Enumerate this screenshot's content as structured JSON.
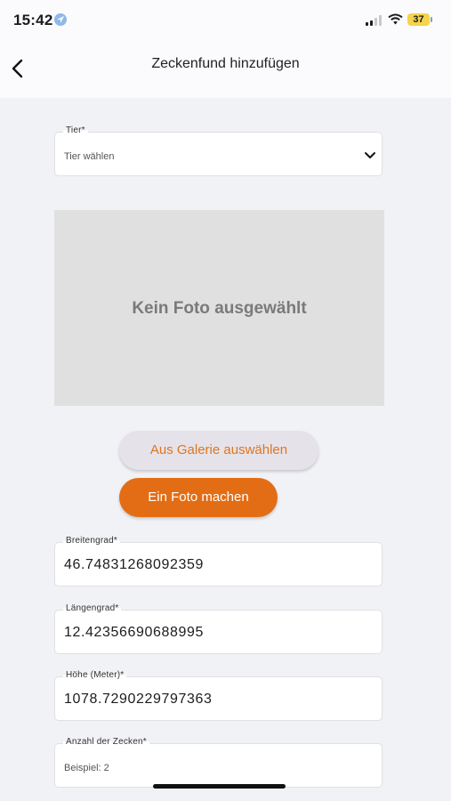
{
  "status_bar": {
    "time": "15:42",
    "battery": "37"
  },
  "nav": {
    "title": "Zeckenfund hinzufügen"
  },
  "animal_field": {
    "label": "Tier*",
    "placeholder": "Tier wählen"
  },
  "photo": {
    "empty_text": "Kein Foto ausgewählt"
  },
  "buttons": {
    "gallery": "Aus Galerie auswählen",
    "camera": "Ein Foto machen"
  },
  "latitude_field": {
    "label": "Breitengrad*",
    "value": "46.74831268092359"
  },
  "longitude_field": {
    "label": "Längengrad*",
    "value": "12.42356690688995"
  },
  "altitude_field": {
    "label": "Höhe (Meter)*",
    "value": "1078.7290229797363"
  },
  "tick_count_field": {
    "label": "Anzahl der Zecken*",
    "placeholder": "Beispiel: 2"
  },
  "colors": {
    "accent": "#e36d14",
    "accent_text": "#e0741f",
    "background": "#f1f2f6"
  }
}
